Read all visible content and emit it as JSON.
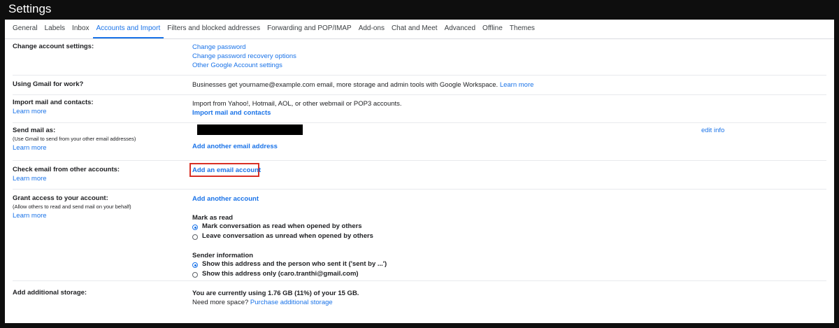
{
  "header": {
    "title": "Settings"
  },
  "tabs": [
    {
      "label": "General"
    },
    {
      "label": "Labels"
    },
    {
      "label": "Inbox"
    },
    {
      "label": "Accounts and Import",
      "active": true
    },
    {
      "label": "Filters and blocked addresses"
    },
    {
      "label": "Forwarding and POP/IMAP"
    },
    {
      "label": "Add-ons"
    },
    {
      "label": "Chat and Meet"
    },
    {
      "label": "Advanced"
    },
    {
      "label": "Offline"
    },
    {
      "label": "Themes"
    }
  ],
  "sections": {
    "change_account": {
      "label": "Change account settings:",
      "links": [
        "Change password",
        "Change password recovery options",
        "Other Google Account settings"
      ]
    },
    "work": {
      "label": "Using Gmail for work?",
      "text": "Businesses get yourname@example.com email, more storage and admin tools with Google Workspace.",
      "link": "Learn more"
    },
    "import": {
      "label": "Import mail and contacts:",
      "learn_more": "Learn more",
      "text": "Import from Yahoo!, Hotmail, AOL, or other webmail or POP3 accounts.",
      "action": "Import mail and contacts"
    },
    "send_as": {
      "label": "Send mail as:",
      "sublabel": "(Use Gmail to send from your other email addresses)",
      "learn_more": "Learn more",
      "edit_info": "edit info",
      "action": "Add another email address"
    },
    "check_email": {
      "label": "Check email from other accounts:",
      "learn_more": "Learn more",
      "action": "Add an email account"
    },
    "grant_access": {
      "label": "Grant access to your account:",
      "sublabel": "(Allow others to read and send mail on your behalf)",
      "learn_more": "Learn more",
      "action": "Add another account",
      "mark_as_read": {
        "title": "Mark as read",
        "options": [
          "Mark conversation as read when opened by others",
          "Leave conversation as unread when opened by others"
        ]
      },
      "sender_info": {
        "title": "Sender information",
        "options": [
          "Show this address and the person who sent it ('sent by ...')",
          "Show this address only (caro.tranthi@gmail.com)"
        ]
      }
    },
    "storage": {
      "label": "Add additional storage:",
      "usage": "You are currently using 1.76 GB (11%) of your 15 GB.",
      "prompt": "Need more space?",
      "link": "Purchase additional storage"
    }
  },
  "colors": {
    "link": "#1a73e8",
    "highlight": "#d93025",
    "background": "#0e0e0e"
  }
}
